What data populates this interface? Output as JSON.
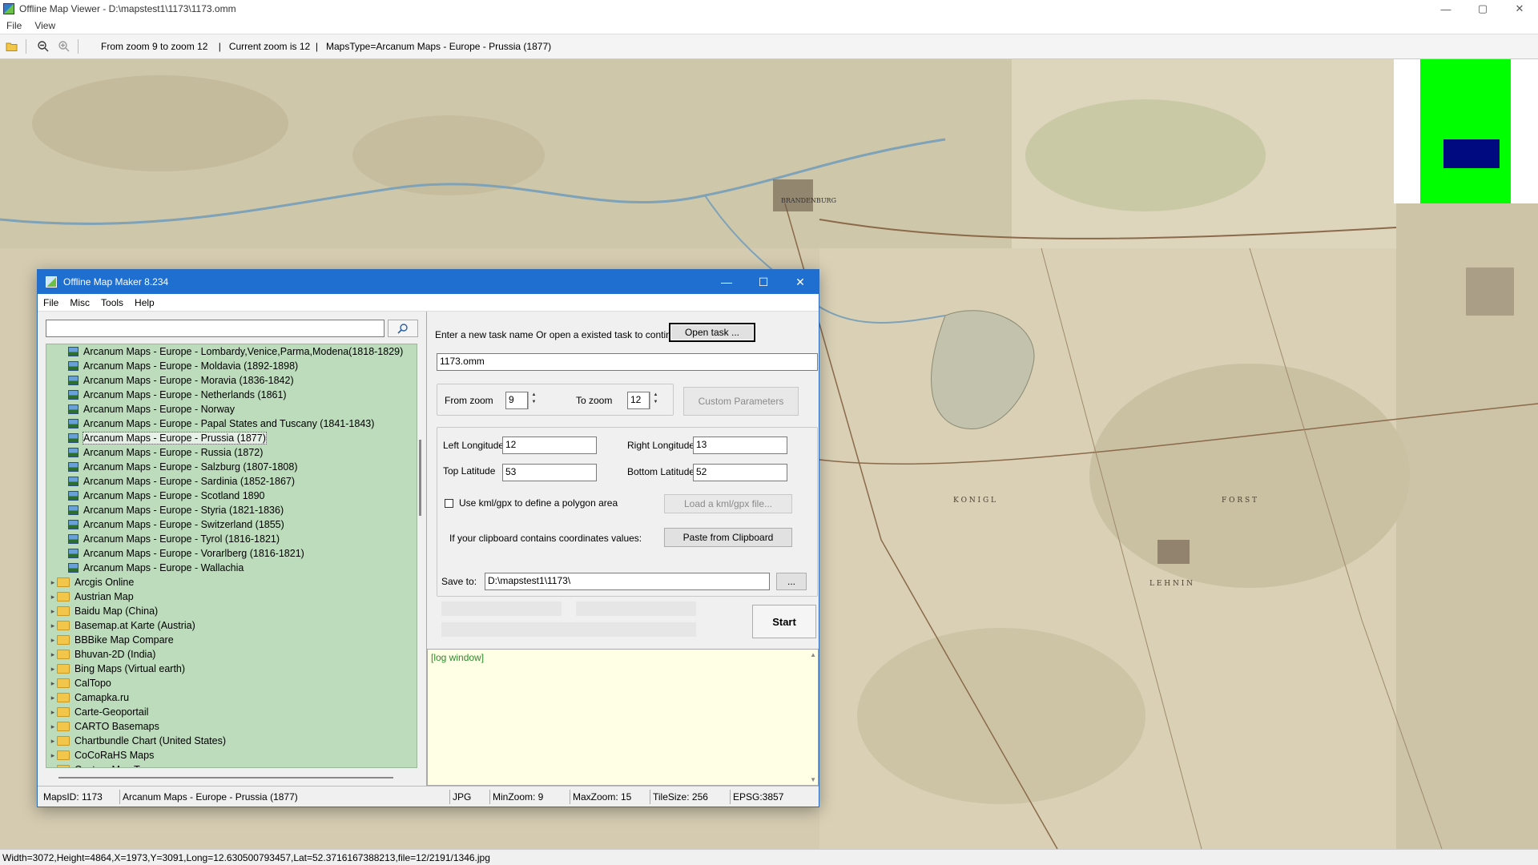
{
  "window": {
    "title": "Offline Map Viewer - D:\\mapstest1\\1173\\1173.omm",
    "controls": [
      "—",
      "▢",
      "✕"
    ]
  },
  "menu": [
    "File",
    "View"
  ],
  "toolbar": {
    "info": "From zoom 9 to zoom 12    |   Current zoom is 12  |   MapsType=Arcanum Maps - Europe - Prussia (1877)"
  },
  "map_labels": [
    "BRANDENBURG",
    "K O N I G L",
    "F O R S T",
    "L E H N I N"
  ],
  "status": "Width=3072,Height=4864,X=1973,Y=3091,Long=12.630500793457,Lat=52.3716167388213,file=12/2191/1346.jpg",
  "dialog": {
    "title": "Offline Map Maker 8.234",
    "controls": [
      "—",
      "☐",
      "✕"
    ],
    "menu": [
      "File",
      "Misc",
      "Tools",
      "Help"
    ],
    "search_value": "",
    "tree": [
      {
        "type": "map",
        "label": "Arcanum Maps - Europe - Lombardy,Venice,Parma,Modena(1818-1829)"
      },
      {
        "type": "map",
        "label": "Arcanum Maps - Europe - Moldavia (1892-1898)"
      },
      {
        "type": "map",
        "label": "Arcanum Maps - Europe - Moravia (1836-1842)"
      },
      {
        "type": "map",
        "label": "Arcanum Maps - Europe - Netherlands (1861)"
      },
      {
        "type": "map",
        "label": "Arcanum Maps - Europe - Norway"
      },
      {
        "type": "map",
        "label": "Arcanum Maps - Europe - Papal States and Tuscany (1841-1843)"
      },
      {
        "type": "map",
        "label": "Arcanum Maps - Europe - Prussia (1877)",
        "selected": true
      },
      {
        "type": "map",
        "label": "Arcanum Maps - Europe - Russia (1872)"
      },
      {
        "type": "map",
        "label": "Arcanum Maps - Europe - Salzburg (1807-1808)"
      },
      {
        "type": "map",
        "label": "Arcanum Maps - Europe - Sardinia (1852-1867)"
      },
      {
        "type": "map",
        "label": "Arcanum Maps - Europe - Scotland 1890"
      },
      {
        "type": "map",
        "label": "Arcanum Maps - Europe - Styria (1821-1836)"
      },
      {
        "type": "map",
        "label": "Arcanum Maps - Europe - Switzerland (1855)"
      },
      {
        "type": "map",
        "label": "Arcanum Maps - Europe - Tyrol (1816-1821)"
      },
      {
        "type": "map",
        "label": "Arcanum Maps - Europe - Vorarlberg (1816-1821)"
      },
      {
        "type": "map",
        "label": "Arcanum Maps - Europe - Wallachia"
      },
      {
        "type": "folder",
        "label": "Arcgis Online"
      },
      {
        "type": "folder",
        "label": "Austrian Map"
      },
      {
        "type": "folder",
        "label": "Baidu Map (China)"
      },
      {
        "type": "folder",
        "label": "Basemap.at Karte (Austria)"
      },
      {
        "type": "folder",
        "label": "BBBike Map Compare"
      },
      {
        "type": "folder",
        "label": "Bhuvan-2D (India)"
      },
      {
        "type": "folder",
        "label": "Bing Maps (Virtual earth)"
      },
      {
        "type": "folder",
        "label": "CalTopo"
      },
      {
        "type": "folder",
        "label": "Camapka.ru"
      },
      {
        "type": "folder",
        "label": "Carte-Geoportail"
      },
      {
        "type": "folder",
        "label": "CARTO Basemaps"
      },
      {
        "type": "folder",
        "label": "Chartbundle Chart (United States)"
      },
      {
        "type": "folder",
        "label": "CoCoRaHS Maps"
      },
      {
        "type": "folder",
        "label": "Custom Map Type"
      }
    ],
    "task_prompt": "Enter a new task name Or open a existed task to continue:",
    "open_task_label": "Open task ...",
    "task_name": "1173.omm",
    "from_zoom_label": "From zoom",
    "from_zoom": "9",
    "to_zoom_label": "To zoom",
    "to_zoom": "12",
    "custom_params_label": "Custom Parameters",
    "left_lon_label": "Left Longitude",
    "left_lon": "12",
    "right_lon_label": "Right Longitude",
    "right_lon": "13",
    "top_lat_label": "Top Latitude",
    "top_lat": "53",
    "bottom_lat_label": "Bottom Latitude",
    "bottom_lat": "52",
    "kml_label": "Use kml/gpx to define a polygon area",
    "load_kml_label": "Load a kml/gpx file...",
    "clipboard_label": "If your clipboard contains coordinates values:",
    "paste_label": "Paste from Clipboard",
    "save_to_label": "Save to:",
    "save_to": "D:\\mapstest1\\1173\\",
    "browse_label": "...",
    "start_label": "Start",
    "log_text": "[log window]",
    "status": {
      "maps_id": "MapsID: 1173",
      "map_name": "Arcanum Maps - Europe - Prussia (1877)",
      "format": "JPG",
      "min_zoom": "MinZoom: 9",
      "max_zoom": "MaxZoom: 15",
      "tile_size": "TileSize: 256",
      "epsg": "EPSG:3857"
    }
  }
}
